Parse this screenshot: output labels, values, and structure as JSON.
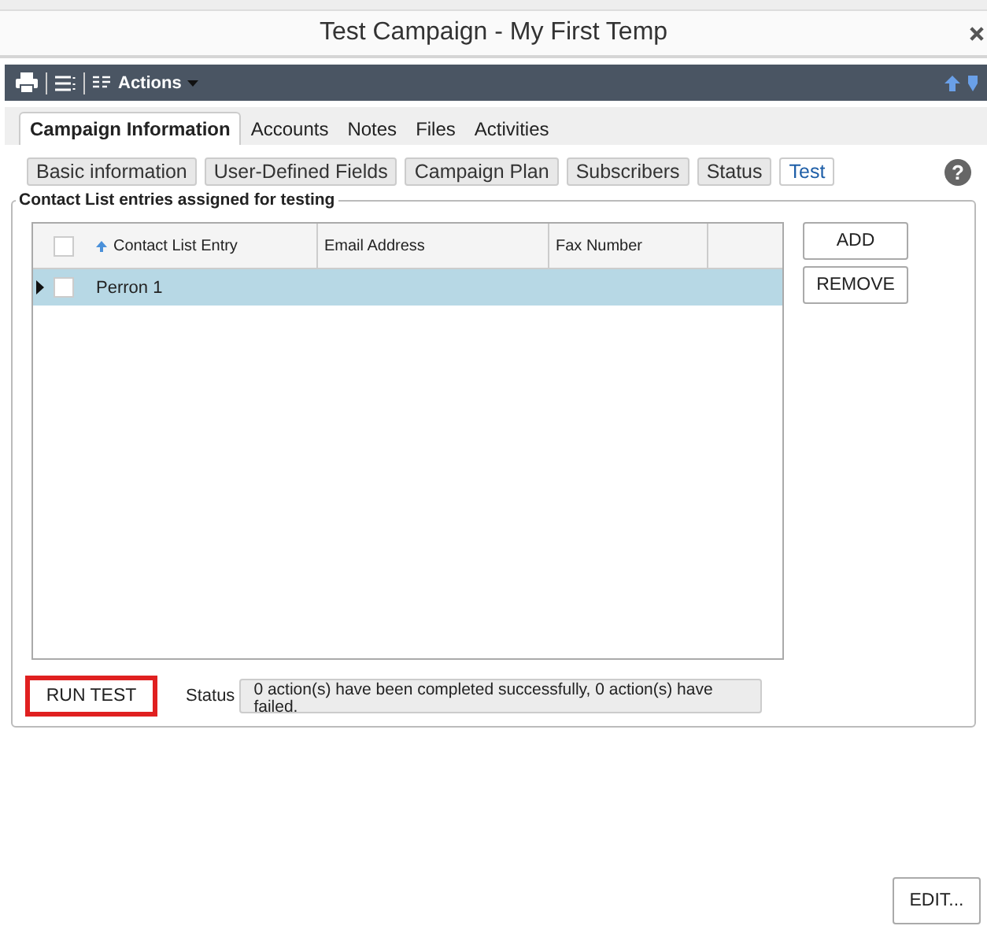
{
  "window": {
    "title": "Test Campaign - My First Temp"
  },
  "toolbar": {
    "actions_label": "Actions"
  },
  "tabs": [
    {
      "label": "Campaign Information",
      "selected": true
    },
    {
      "label": "Accounts",
      "selected": false
    },
    {
      "label": "Notes",
      "selected": false
    },
    {
      "label": "Files",
      "selected": false
    },
    {
      "label": "Activities",
      "selected": false
    }
  ],
  "subtabs": [
    {
      "label": "Basic information",
      "selected": false
    },
    {
      "label": "User-Defined Fields",
      "selected": false
    },
    {
      "label": "Campaign Plan",
      "selected": false
    },
    {
      "label": "Subscribers",
      "selected": false
    },
    {
      "label": "Status",
      "selected": false
    },
    {
      "label": "Test",
      "selected": true
    }
  ],
  "group": {
    "title": "Contact List entries assigned for testing"
  },
  "help": "?",
  "table": {
    "all_checked": false,
    "columns": [
      "Contact List Entry",
      "Email Address",
      "Fax Number"
    ],
    "rows": [
      {
        "cells": [
          "Perron 1",
          "",
          ""
        ],
        "selected": true,
        "checked": false
      }
    ]
  },
  "side_buttons": [
    "ADD",
    "REMOVE"
  ],
  "run_button": "RUN TEST",
  "status": {
    "label": "Status",
    "value": "0 action(s) have been completed successfully, 0 action(s) have failed."
  },
  "edit_button": "EDIT..."
}
